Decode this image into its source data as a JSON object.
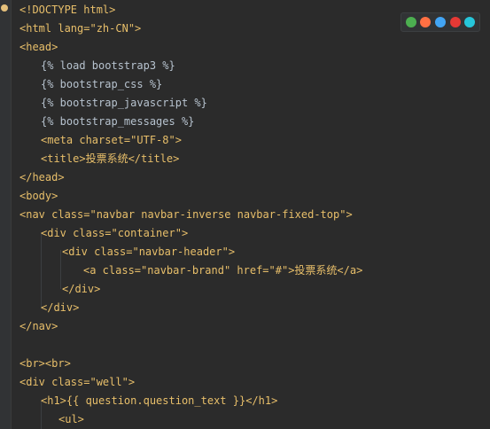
{
  "editor": {
    "lines": [
      "<!DOCTYPE html>",
      "<html lang=\"zh-CN\">",
      "<head>",
      "{% load bootstrap3 %}",
      "{% bootstrap_css %}",
      "{% bootstrap_javascript %}",
      "{% bootstrap_messages %}",
      "<meta charset=\"UTF-8\">",
      "<title>投票系统</title>",
      "</head>",
      "<body>",
      "<nav class=\"navbar navbar-inverse navbar-fixed-top\">",
      "<div class=\"container\">",
      "<div class=\"navbar-header\">",
      "<a class=\"navbar-brand\" href=\"#\">投票系统</a>",
      "</div>",
      "</div>",
      "</nav>",
      "",
      "<br><br>",
      "<div class=\"well\">",
      "<h1>{{ question.question_text }}</h1>",
      "<ul>"
    ]
  },
  "browser_icons": [
    {
      "name": "chrome-icon",
      "color": "#4caf50"
    },
    {
      "name": "firefox-icon",
      "color": "#ff7043"
    },
    {
      "name": "safari-icon",
      "color": "#42a5f5"
    },
    {
      "name": "opera-icon",
      "color": "#e53935"
    },
    {
      "name": "edge-icon",
      "color": "#26c6da"
    }
  ]
}
